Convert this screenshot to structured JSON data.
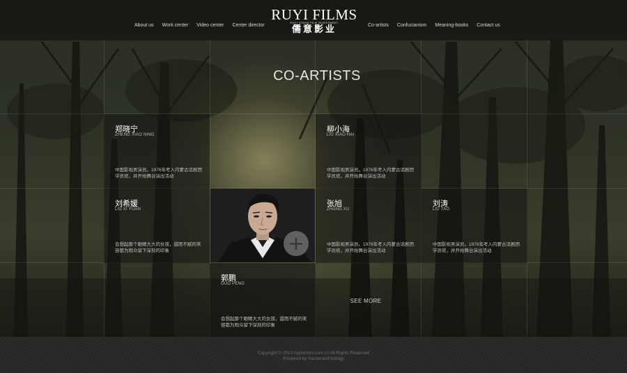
{
  "logo": {
    "name_en": "RUYI FILMS",
    "subtitle": "RUYI XINXIN FILM INVESTMENT",
    "name_cn": "儒意影业"
  },
  "nav": {
    "left": [
      "About us",
      "Work center",
      "Video center",
      "Center director"
    ],
    "right": [
      "Co-artists",
      "Confucianism",
      "Meaning-books",
      "Contact us"
    ]
  },
  "section_title": "CO-ARTISTS",
  "artists": [
    {
      "name": "郑晓宁",
      "pinyin": "ZHENG XIAO NING",
      "desc": "中国影视男演员。1976年考入内蒙古话剧团学员班，并开始舞台演出活动"
    },
    {
      "name": "柳小海",
      "pinyin": "LIU XIAO HAI",
      "desc": "中国影视男演员。1976年考入内蒙古话剧团学员班，并开始舞台演出活动"
    },
    {
      "name": "刘希媛",
      "pinyin": "LIU XI YUAN",
      "desc": "会想起那个眼睛大大的女孩，甜而不腻的笑容都为观众留下深刻的印象"
    },
    {
      "name": "张旭",
      "pinyin": "ZHANG XU",
      "desc": "中国影视男演员。1976年考入内蒙古话剧团学员班，并开始舞台演出活动"
    },
    {
      "name": "刘涛",
      "pinyin": "LIU TAO",
      "desc": "中国影视男演员。1976年考入内蒙古话剧团学员班，并开始舞台演出活动"
    },
    {
      "name": "郭鹏",
      "pinyin": "GUO PENG",
      "desc": "会想起那个眼睛大大的女孩，甜而不腻的笑容都为观众留下深刻的印象"
    }
  ],
  "featured": {
    "plus_icon": "plus-circle-icon"
  },
  "see_more": "SEE MORE",
  "footer": {
    "copyright": "Copyright © 2013 ruyixinxin.com.cn  All Rights Reserved",
    "powered": "Powered by fractal-technology"
  }
}
